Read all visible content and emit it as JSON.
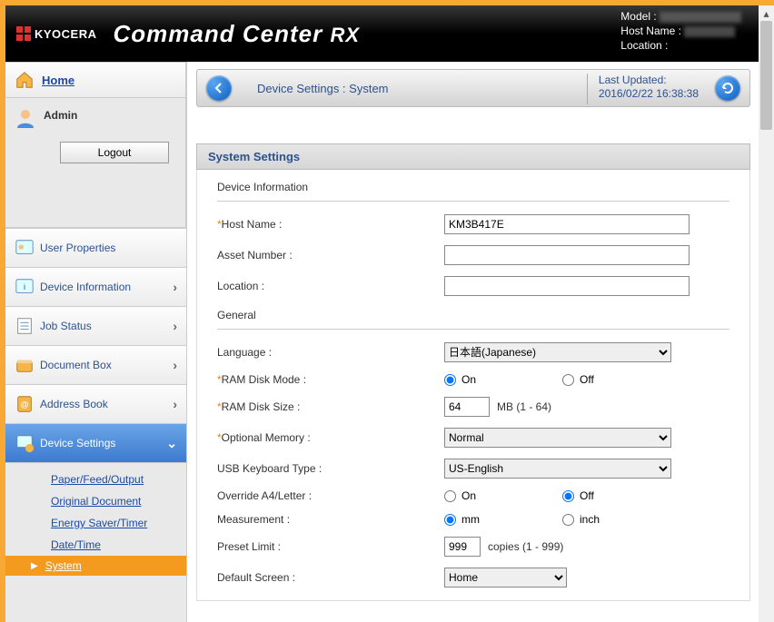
{
  "brand": "KYOCERA",
  "title_main": "Command Center",
  "title_suffix": "RX",
  "header_info": {
    "model_label": "Model :",
    "hostname_label": "Host Name :",
    "location_label": "Location :"
  },
  "sidebar": {
    "home": "Home",
    "admin": "Admin",
    "logout": "Logout",
    "nav": [
      {
        "label": "User Properties"
      },
      {
        "label": "Device Information"
      },
      {
        "label": "Job Status"
      },
      {
        "label": "Document Box"
      },
      {
        "label": "Address Book"
      },
      {
        "label": "Device Settings"
      }
    ],
    "sub": [
      "Paper/Feed/Output",
      "Original Document",
      "Energy Saver/Timer",
      "Date/Time",
      "System"
    ]
  },
  "crumb": {
    "path": "Device Settings : System",
    "updated_label": "Last Updated:",
    "updated_value": "2016/02/22 16:38:38"
  },
  "panel": {
    "title": "System Settings",
    "device_info_head": "Device Information",
    "general_head": "General",
    "host_name_label": "Host Name :",
    "host_name_value": "KM3B417E",
    "asset_label": "Asset Number :",
    "asset_value": "",
    "location_label": "Location :",
    "location_value": "",
    "language_label": "Language :",
    "language_value": "日本語(Japanese)",
    "ramdisk_mode_label": "RAM Disk Mode :",
    "ramdisk_size_label": "RAM Disk Size :",
    "ramdisk_size_value": "64",
    "ramdisk_size_hint": "MB (1 - 64)",
    "optmem_label": "Optional Memory :",
    "optmem_value": "Normal",
    "usbkbd_label": "USB Keyboard Type :",
    "usbkbd_value": "US-English",
    "override_label": "Override A4/Letter :",
    "measurement_label": "Measurement :",
    "preset_label": "Preset Limit :",
    "preset_value": "999",
    "preset_hint": "copies (1 - 999)",
    "defscreen_label": "Default Screen :",
    "defscreen_value": "Home",
    "radio_on": "On",
    "radio_off": "Off",
    "radio_mm": "mm",
    "radio_inch": "inch"
  },
  "chart_data": null
}
